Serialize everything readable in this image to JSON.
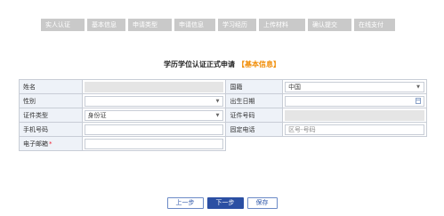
{
  "steps": [
    "实人认证",
    "基本信息",
    "申请类型",
    "申请信息",
    "学习经历",
    "上传材料",
    "确认提交",
    "在线支付"
  ],
  "page": {
    "title": "学历学位认证正式申请",
    "subtitle": "【基本信息】"
  },
  "form": {
    "name_label": "姓名",
    "nationality_label": "国籍",
    "nationality_value": "中国",
    "gender_label": "性别",
    "birthdate_label": "出生日期",
    "id_type_label": "证件类型",
    "id_type_value": "身份证",
    "id_number_label": "证件号码",
    "mobile_label": "手机号码",
    "landline_label": "固定电话",
    "landline_placeholder": "区号-号码",
    "email_label": "电子邮箱",
    "required_mark": "*"
  },
  "buttons": {
    "prev": "上一步",
    "next": "下一步",
    "save": "保存"
  },
  "colors": {
    "step_bg": "#c9c9c9",
    "label_bg": "#eef2f8",
    "accent_orange": "#f08a00",
    "primary_button": "#2b4fa3"
  }
}
